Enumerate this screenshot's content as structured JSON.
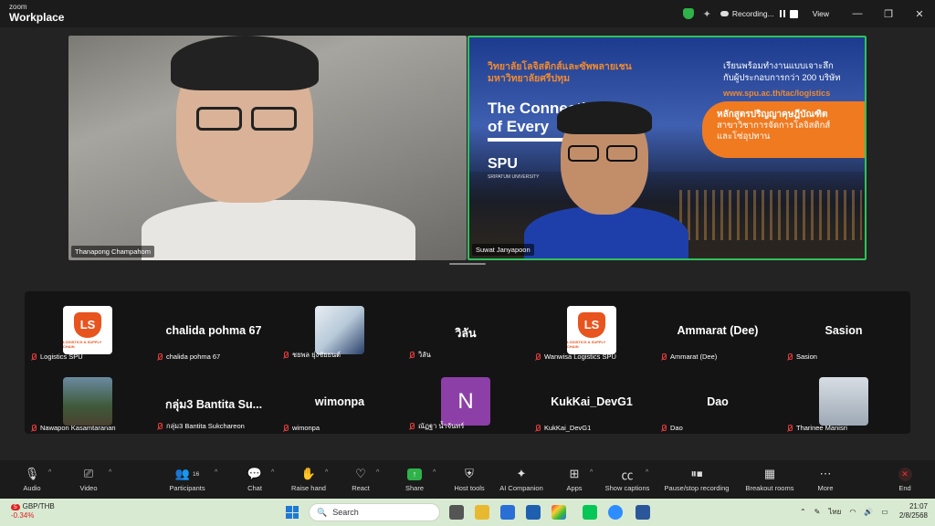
{
  "app": {
    "brand_top": "zoom",
    "brand_bottom": "Workplace"
  },
  "titlebar": {
    "recording_label": "Recording...",
    "view_label": "View",
    "icons": [
      "shield-check-icon",
      "sparkle-icon",
      "cloud-icon",
      "pause-icon",
      "stop-icon",
      "minimize-icon",
      "restore-icon",
      "close-icon"
    ]
  },
  "videos": [
    {
      "name": "Thanapong Champahom"
    },
    {
      "name": "Suwat Janyapoon",
      "slide": {
        "thai_title_1": "วิทยาลัยโลจิสติกส์และซัพพลายเชน",
        "thai_title_2": "มหาวิทยาลัยศรีปทุม",
        "headline_1": "The Connectivity",
        "headline_2": "of Every",
        "logo": "SPU",
        "logo_sub": "SRIPATUM UNIVERSITY",
        "right_1": "เรียนพร้อมทำงานแบบเจาะลึก",
        "right_2": "กับผู้ประกอบการกว่า 200 บริษัท",
        "url": "www.spu.ac.th/tac/logistics",
        "orange_1": "หลักสูตรปริญญาคุษฎีบัณฑิต",
        "orange_2": "สาขาวิชาการจัดการโลจิสติกส์",
        "orange_3": "และโซ่อุปทาน"
      }
    }
  ],
  "gallery": {
    "row1": [
      {
        "display": "",
        "label": "Logistics SPU",
        "avatar": "logo",
        "logo_text": "LOGISTICS & SUPPLY CHAIN"
      },
      {
        "display": "chalida pohma 67",
        "label": "chalida pohma 67"
      },
      {
        "display": "",
        "label": "ชยพล ยุ่งชัยยนต์",
        "avatar": "poster"
      },
      {
        "display": "วิลัน",
        "label": "วิลัน"
      },
      {
        "display": "",
        "label": "Wanwisa Logistics SPU",
        "avatar": "logo",
        "logo_text": "LOGISTICS & SUPPLY CHAIN"
      },
      {
        "display": "Ammarat (Dee)",
        "label": "Ammarat (Dee)"
      },
      {
        "display": "Sasion",
        "label": "Sasion"
      }
    ],
    "row2": [
      {
        "display": "",
        "label": "Nawapon Kasamtaranan",
        "avatar": "photo"
      },
      {
        "display": "กลุ่ม3 Bantita Su...",
        "label": "กลุ่ม3 Bantita Sukchareon"
      },
      {
        "display": "wimonpa",
        "label": "wimonpa"
      },
      {
        "display": "N",
        "label": "ณัฏฐา น้ำจันทร์",
        "avatar": "letter"
      },
      {
        "display": "KukKai_DevG1",
        "label": "KukKai_DevG1"
      },
      {
        "display": "Dao",
        "label": "Dao"
      },
      {
        "display": "",
        "label": "Tharinee Manisri",
        "avatar": "portrait"
      }
    ]
  },
  "toolbar": {
    "audio": "Audio",
    "video": "Video",
    "participants": "Participants",
    "participants_count": "16",
    "chat": "Chat",
    "raise_hand": "Raise hand",
    "react": "React",
    "share": "Share",
    "host_tools": "Host tools",
    "ai_companion": "AI Companion",
    "apps": "Apps",
    "show_captions": "Show captions",
    "pause_recording": "Pause/stop recording",
    "breakout_rooms": "Breakout rooms",
    "more": "More",
    "end": "End"
  },
  "taskbar": {
    "notification_count": "5",
    "ticker": "GBP/THB",
    "ticker_change": "-0.34%",
    "search_placeholder": "Search",
    "language": "ไทย",
    "time": "21:07",
    "date": "2/8/2568"
  }
}
